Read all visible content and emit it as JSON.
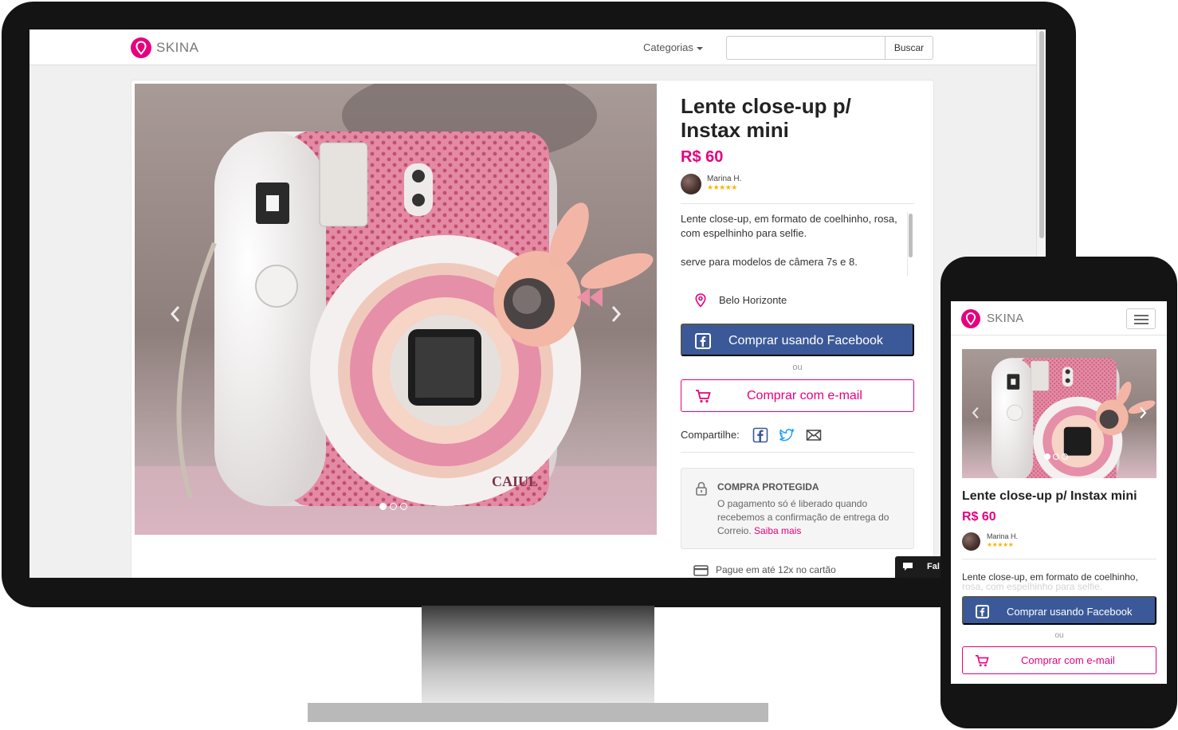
{
  "brand": {
    "name": "SKINA",
    "accent": "#e6007e",
    "facebook_blue": "#3b5998"
  },
  "desktop": {
    "nav": {
      "categories_label": "Categorias",
      "search_placeholder": "",
      "search_button": "Buscar"
    },
    "product": {
      "title": "Lente close-up p/ Instax mini",
      "price": "R$ 60",
      "seller": {
        "name": "Marina H.",
        "stars": "★★★★★",
        "rating": 5
      },
      "description": [
        "Lente close-up, em formato de coelhinho, rosa, com espelhinho para selfie.",
        "serve para modelos de câmera 7s e 8."
      ],
      "location": "Belo Horizonte",
      "buy_facebook": "Comprar usando Facebook",
      "or_label": "ou",
      "buy_email": "Comprar com e-mail",
      "share_label": "Compartilhe:",
      "share_icons": [
        "facebook-icon",
        "twitter-icon",
        "mail-icon"
      ],
      "protection": {
        "title": "COMPRA PROTEGIDA",
        "text": "O pagamento só é liberado quando recebemos a confirmação de entrega do Correio.",
        "link": "Saiba mais"
      },
      "payment": "Pague em até 12x no cartão",
      "image_brand": "CAIUL",
      "carousel": {
        "slides": 3,
        "active": 1
      }
    },
    "chat_label": "Fal"
  },
  "mobile": {
    "product": {
      "title": "Lente close-up p/ Instax mini",
      "price": "R$ 60",
      "seller": {
        "name": "Marina H.",
        "stars": "★★★★★"
      },
      "description_line1": "Lente close-up, em formato de coelhinho,",
      "description_line2": "rosa, com espelhinho para selfie.",
      "buy_facebook": "Comprar usando Facebook",
      "or_label": "ou",
      "buy_email": "Comprar com e-mail",
      "carousel": {
        "slides": 3,
        "active": 1
      }
    }
  }
}
